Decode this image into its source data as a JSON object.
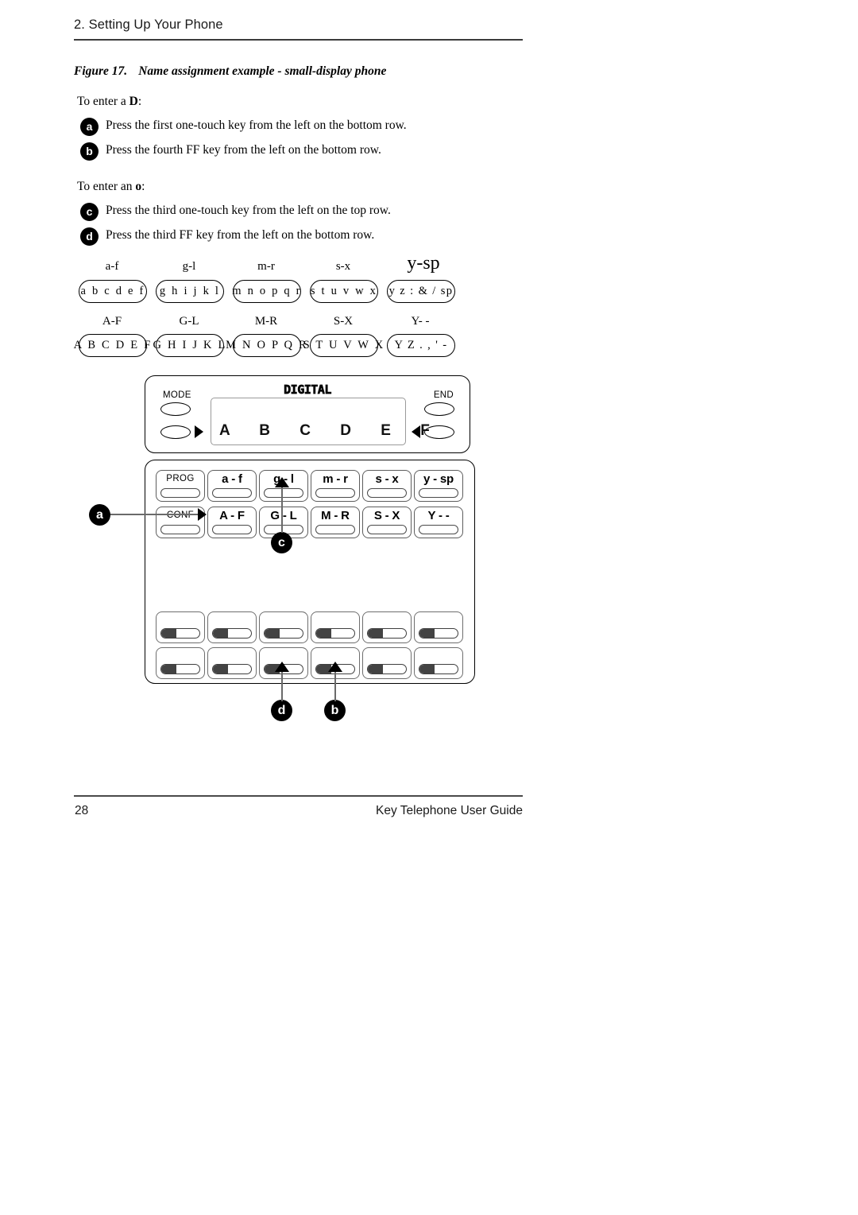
{
  "header": {
    "chapter_title": "2. Setting Up Your Phone"
  },
  "figure": {
    "number": "Figure 17.",
    "caption": "Name assignment example - small-display phone"
  },
  "instructions": {
    "lead_d_prefix": "To enter a ",
    "lead_d_bold": "D",
    "lead_d_suffix": ":",
    "lead_o_prefix": "To enter an ",
    "lead_o_bold": "o",
    "lead_o_suffix": ":",
    "steps": [
      {
        "badge": "a",
        "text": "Press the first one-touch key from the left on the bottom row."
      },
      {
        "badge": "b",
        "text": "Press the fourth FF key from the left on the bottom row."
      },
      {
        "badge": "c",
        "text": "Press the third one-touch key from the left on the top row."
      },
      {
        "badge": "d",
        "text": "Press the third FF key from the left on the bottom row."
      }
    ]
  },
  "legend": {
    "lowercase_row": [
      {
        "label": "a-f",
        "chars": "a b c d e f"
      },
      {
        "label": "g-l",
        "chars": "g h i j k l"
      },
      {
        "label": "m-r",
        "chars": "m n o p q r"
      },
      {
        "label": "s-x",
        "chars": "s t u v w x"
      },
      {
        "label": "y-sp",
        "chars": "y z : & / sp"
      }
    ],
    "uppercase_row": [
      {
        "label": "A-F",
        "chars": "A B C D E F"
      },
      {
        "label": "G-L",
        "chars": "G H I J K L"
      },
      {
        "label": "M-R",
        "chars": "M N O P Q R"
      },
      {
        "label": "S-X",
        "chars": "S T U V W X"
      },
      {
        "label": "Y- -",
        "chars": "Y Z . , ' -"
      }
    ]
  },
  "phone": {
    "brand": "DIGITAL",
    "mode_label": "MODE",
    "end_label": "END",
    "display_text": "A B C D E F",
    "soft_keys_top": [
      "PROG",
      "a - f",
      "g - l",
      "m - r",
      "s - x",
      "y - sp"
    ],
    "soft_keys_bottom": [
      "CONF",
      "A - F",
      "G - L",
      "M - R",
      "S - X",
      "Y - -"
    ],
    "callouts": [
      {
        "id": "a",
        "label": "a"
      },
      {
        "id": "c",
        "label": "c"
      },
      {
        "id": "d",
        "label": "d"
      },
      {
        "id": "b",
        "label": "b"
      }
    ],
    "ff_rows": 2,
    "ff_cols": 6
  },
  "footer": {
    "page_number": "28",
    "guide_title": "Key Telephone User Guide"
  }
}
